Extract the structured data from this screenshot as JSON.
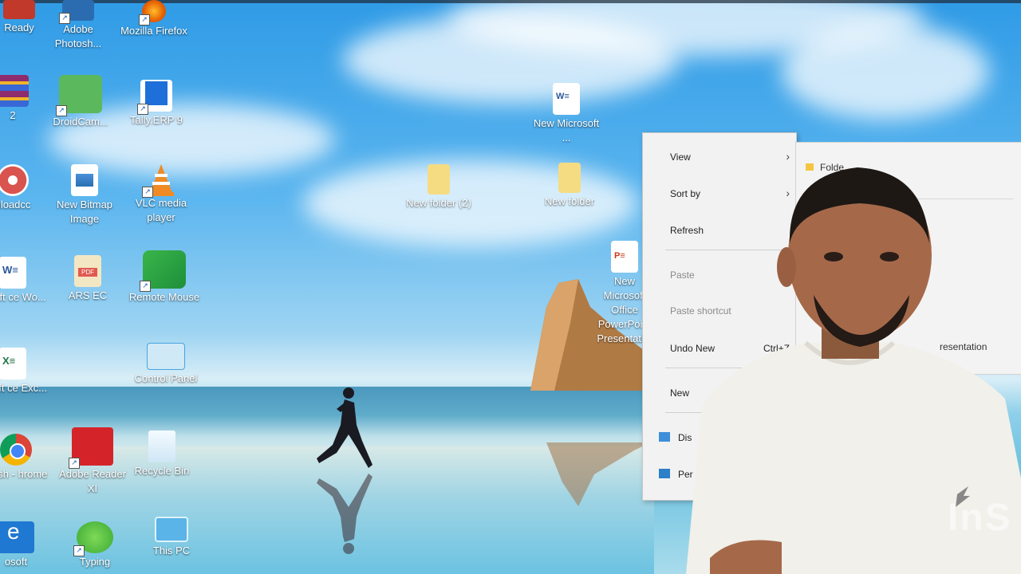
{
  "desktop": {
    "icons": [
      {
        "id": "ready",
        "label": "Ready",
        "color": "#c0392b"
      },
      {
        "id": "photoshop",
        "label": "Adobe Photosh...",
        "color": "#2b6cb0"
      },
      {
        "id": "firefox",
        "label": "Mozilla Firefox",
        "color": "#e66000"
      },
      {
        "id": "winrar",
        "label": "2",
        "color": "#8e2c6e"
      },
      {
        "id": "droidcam",
        "label": "DroidCam...",
        "color": "#5cb85c"
      },
      {
        "id": "tally",
        "label": "Tally.ERP 9",
        "color": "#1e6fd9"
      },
      {
        "id": "downloader",
        "label": "nloadcc",
        "color": "#d9534f"
      },
      {
        "id": "bitmap",
        "label": "New Bitmap Image",
        "color": "#4a90d9"
      },
      {
        "id": "vlc",
        "label": "VLC media player",
        "color": "#f08a24"
      },
      {
        "id": "word",
        "label": "rosoft ce Wo...",
        "color": "#2b579a"
      },
      {
        "id": "pdf",
        "label": "ARS EC",
        "color": "#e8c98a"
      },
      {
        "id": "remote",
        "label": "Remote Mouse",
        "color": "#39b54a"
      },
      {
        "id": "controlpanel",
        "label": "Control Panel",
        "color": "#4aa3df"
      },
      {
        "id": "excel",
        "label": "rosoft ce Exc...",
        "color": "#217346"
      },
      {
        "id": "chrome",
        "label": "ikash - hrome",
        "color": "#db4437"
      },
      {
        "id": "acrobat",
        "label": "Adobe Reader XI",
        "color": "#d4242a"
      },
      {
        "id": "recycle",
        "label": "Recycle Bin",
        "color": "#cfe6f5"
      },
      {
        "id": "edge",
        "label": "osoft",
        "color": "#1f78d1"
      },
      {
        "id": "typing",
        "label": "Typing",
        "color": "#3aa935"
      },
      {
        "id": "thispc",
        "label": "This PC",
        "color": "#5ab4e8"
      },
      {
        "id": "newword",
        "label": "New Microsoft ...",
        "color": "#ffffff"
      },
      {
        "id": "newfolder2",
        "label": "New folder (2)",
        "color": "#f5dc82"
      },
      {
        "id": "newfolder",
        "label": "New folder",
        "color": "#f5dc82"
      },
      {
        "id": "newppt",
        "label": "New Microsoft Office PowerPoint Presentati...",
        "color": "#ffffff"
      }
    ]
  },
  "context_menu": {
    "view": "View",
    "sort_by": "Sort by",
    "refresh": "Refresh",
    "paste": "Paste",
    "paste_shortcut": "Paste shortcut",
    "undo_new": "Undo New",
    "undo_shortcut": "Ctrl+Z",
    "new": "New",
    "display": "Dis",
    "personalize": "Per"
  },
  "submenu": {
    "folder": "Folde",
    "presentation": "resentation"
  },
  "watermark": "InS"
}
